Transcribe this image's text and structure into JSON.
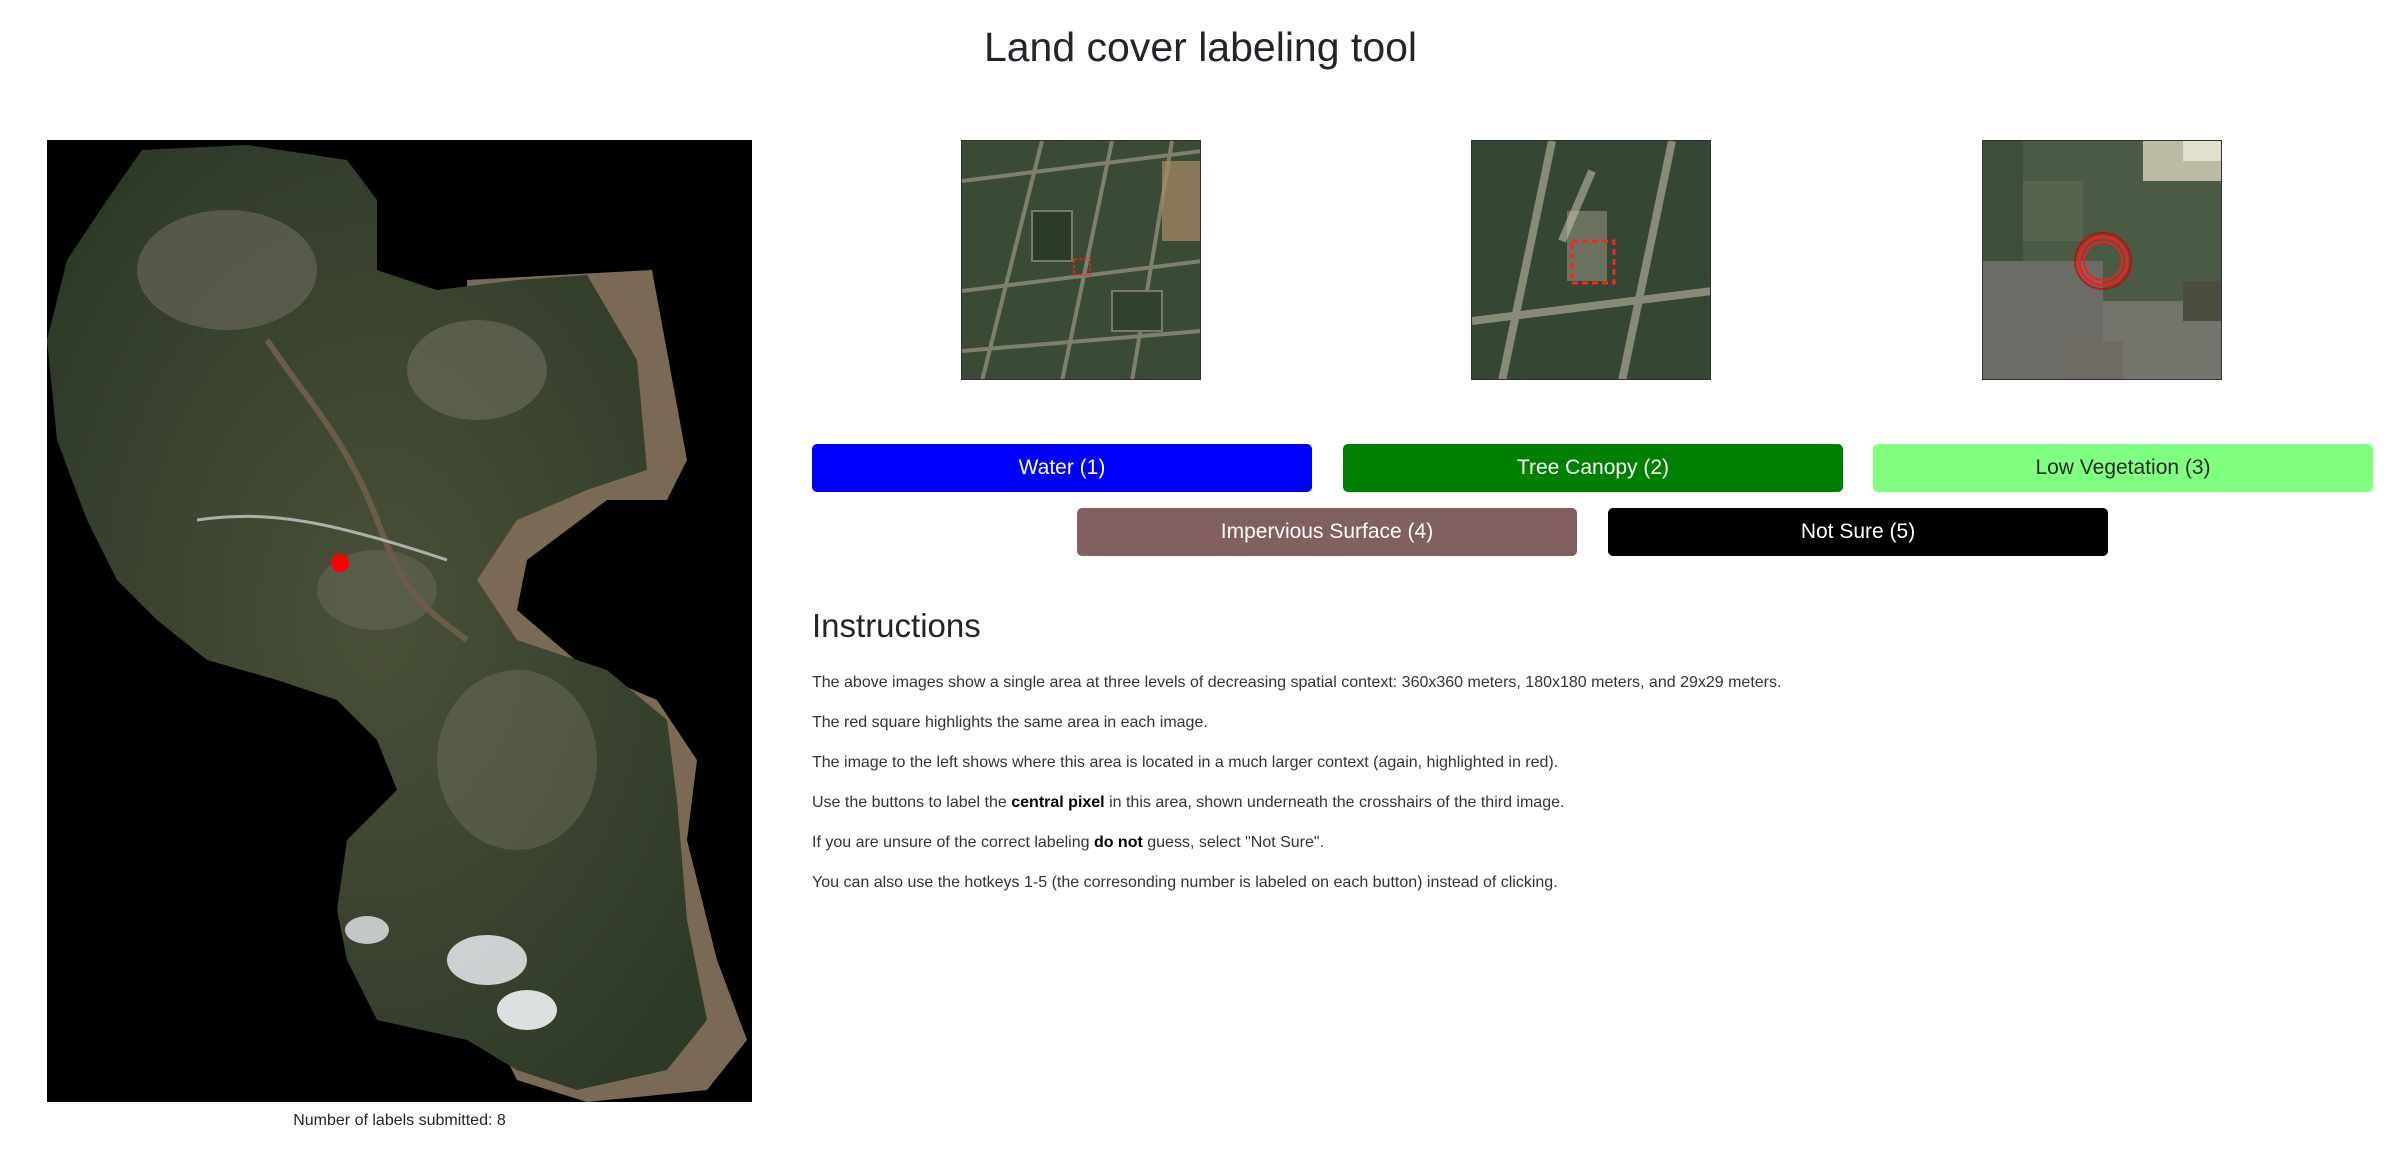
{
  "page": {
    "title": "Land cover labeling tool"
  },
  "overview": {
    "labels_submitted": "Number of labels submitted: 8"
  },
  "buttons": {
    "water": "Water (1)",
    "tree_canopy": "Tree Canopy (2)",
    "low_vegetation": "Low Vegetation (3)",
    "impervious": "Impervious Surface (4)",
    "not_sure": "Not Sure (5)"
  },
  "colors": {
    "water": "#0000ff",
    "tree_canopy": "#008000",
    "low_vegetation": "#80ff80",
    "impervious": "#806060",
    "not_sure": "#000000",
    "highlight": "#ff0000"
  },
  "instructions": {
    "heading": "Instructions",
    "p1": "The above images show a single area at three levels of decreasing spatial context: 360x360 meters, 180x180 meters, and 29x29 meters.",
    "p2": "The red square highlights the same area in each image.",
    "p3": "The image to the left shows where this area is located in a much larger context (again, highlighted in red).",
    "p4_before": "Use the buttons to label the ",
    "p4_bold": "central pixel",
    "p4_after": " in this area, shown underneath the crosshairs of the third image.",
    "p5_before": "If you are unsure of the correct labeling ",
    "p5_bold": "do not",
    "p5_after": " guess, select \"Not Sure\".",
    "p6": "You can also use the hotkeys 1-5 (the corresonding number is labeled on each button) instead of clicking."
  }
}
